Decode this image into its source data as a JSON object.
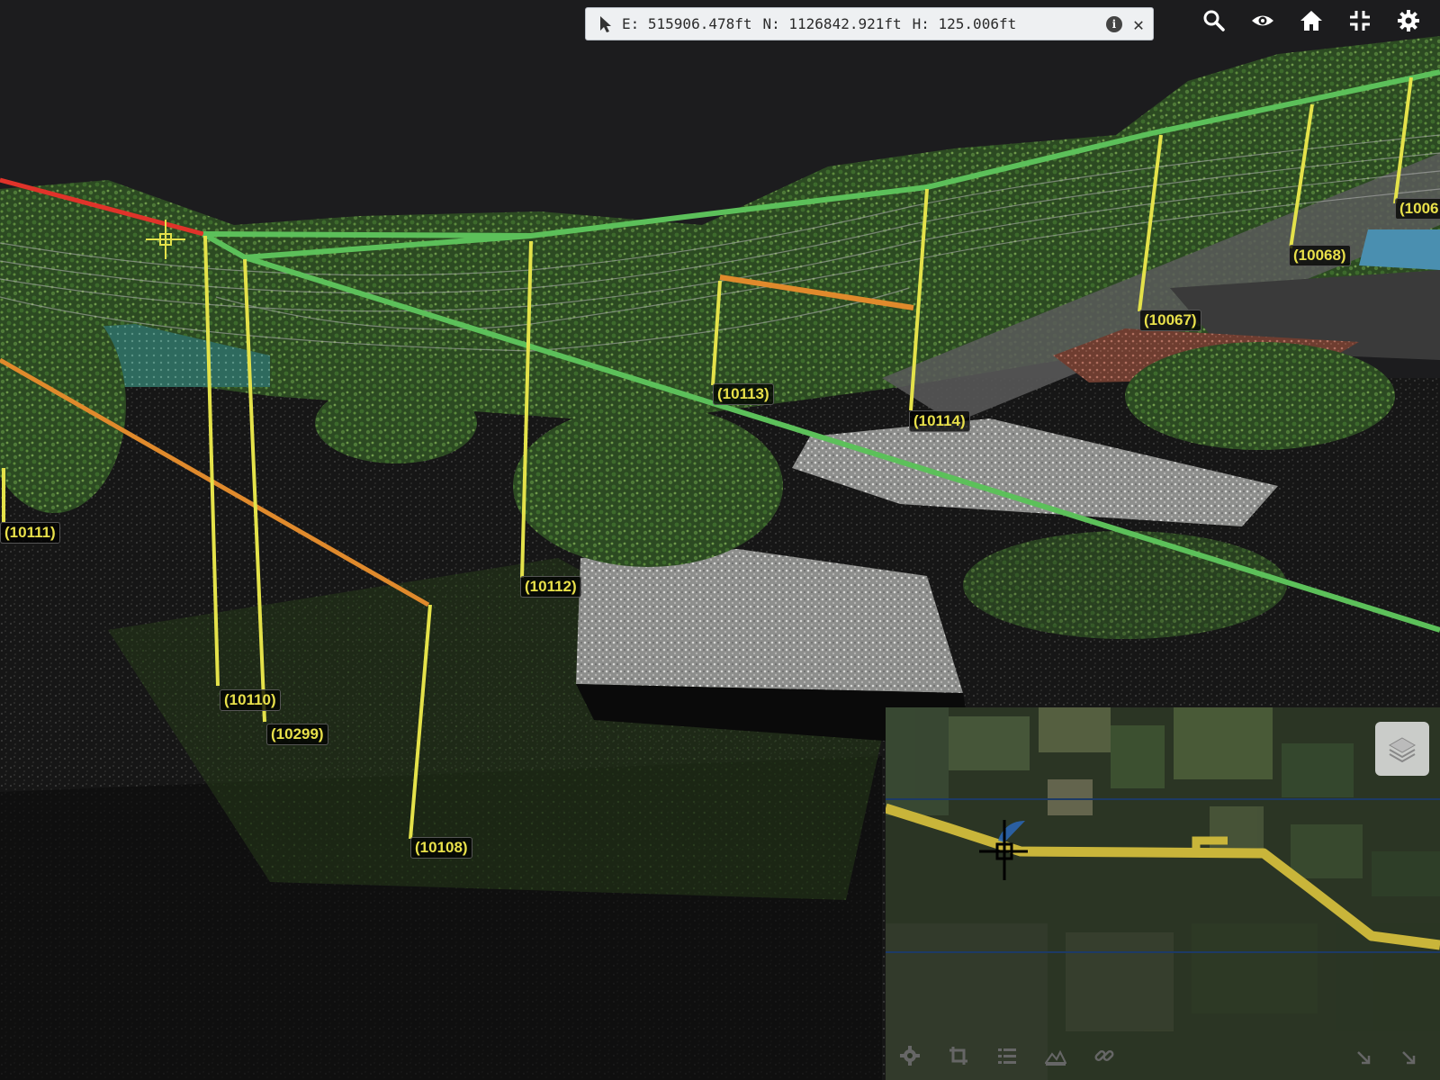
{
  "coordinates": {
    "easting": "E: 515906.478ft",
    "northing": "N: 1126842.921ft",
    "height": "H: 125.006ft",
    "info_glyph": "i",
    "close_glyph": "✕"
  },
  "toolbar": {
    "items": [
      {
        "icon": "search-icon"
      },
      {
        "icon": "eye-icon"
      },
      {
        "icon": "home-icon"
      },
      {
        "icon": "collapse-icon"
      },
      {
        "icon": "gear-icon"
      }
    ]
  },
  "poles": {
    "p10111": "(10111)",
    "p10110": "(10110)",
    "p10299": "(10299)",
    "p10108": "(10108)",
    "p10112": "(10112)",
    "p10113": "(10113)",
    "p10114": "(10114)",
    "p10067": "(10067)",
    "p10068": "(10068)",
    "p1006x": "(1006"
  },
  "colors": {
    "span_ok": "#5cc05a",
    "span_warn": "#e08a2c",
    "span_alert": "#e0332a",
    "pole": "#e4e24a",
    "route": "#c9b53a"
  },
  "minimap": {
    "layers_icon": "layers-icon",
    "tools": [
      "gear-icon",
      "crop-icon",
      "list-icon",
      "profile-icon",
      "link-icon"
    ],
    "corners": [
      "expand-icon",
      "resize-icon"
    ]
  }
}
